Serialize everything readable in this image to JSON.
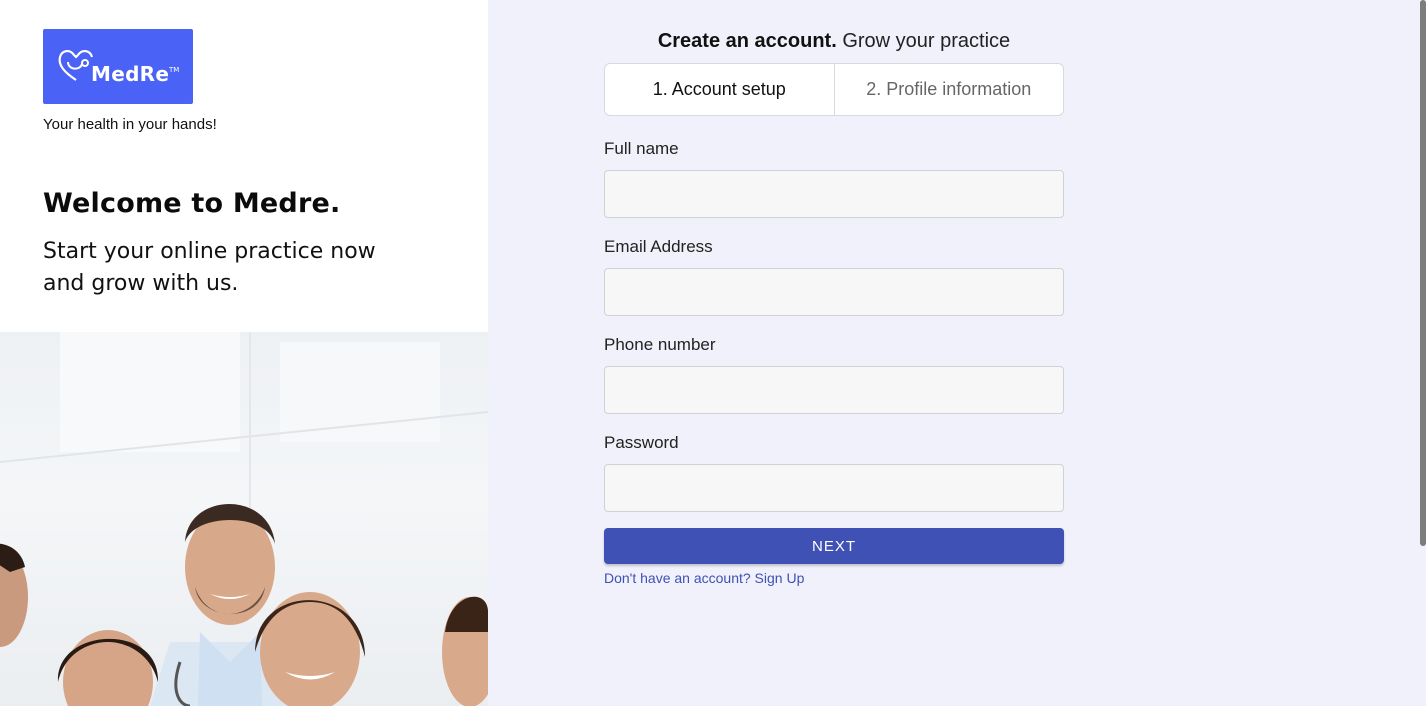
{
  "brand": {
    "logo_text": "MedRe",
    "logo_tm": "TM",
    "tagline": "Your health in your hands!",
    "accent_color": "#4a62f5"
  },
  "hero": {
    "welcome": "Welcome to Medre.",
    "subtitle": "Start your online practice now and grow with us."
  },
  "form": {
    "title_bold": "Create an account.",
    "title_rest": " Grow your practice",
    "tabs": [
      {
        "label": "1. Account setup",
        "active": true
      },
      {
        "label": "2. Profile information",
        "active": false
      }
    ],
    "fields": {
      "full_name": {
        "label": "Full name",
        "value": ""
      },
      "email": {
        "label": "Email Address",
        "value": ""
      },
      "phone": {
        "label": "Phone number",
        "value": ""
      },
      "password": {
        "label": "Password",
        "value": ""
      }
    },
    "next_label": "NEXT",
    "signup_link": "Don't have an account? Sign Up",
    "button_color": "#3f51b5"
  }
}
